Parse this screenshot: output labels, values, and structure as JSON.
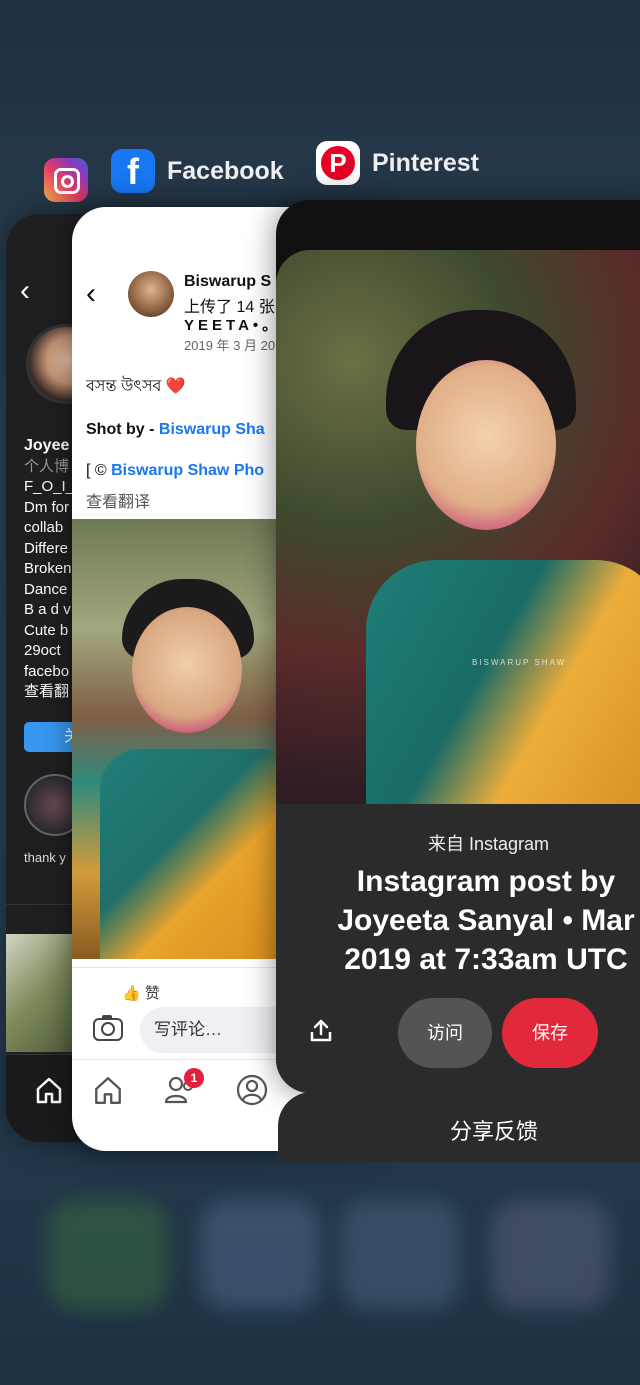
{
  "app_switcher": {
    "instagram": {
      "icon": "instagram-icon"
    },
    "facebook": {
      "label": "Facebook",
      "icon": "facebook-icon"
    },
    "pinterest": {
      "label": "Pinterest",
      "icon": "pinterest-icon"
    }
  },
  "instagram_card": {
    "bio_lines": [
      "Joyee",
      "个人博",
      "F_O_I_I",
      "Dm for",
      "collab",
      "Differe",
      "Broken",
      "Dance",
      "B a d v",
      "Cute b",
      "29oct",
      "facebo",
      "查看翻"
    ],
    "button_label": "关",
    "story_label": "thank y"
  },
  "facebook_card": {
    "author": "Biswarup S",
    "uploaded": "上传了 14 张",
    "album_title": "YEETA•。",
    "date": "2019 年 3 月 20",
    "caption_line1": "বসন্ত উৎসব ❤️",
    "shot_by_prefix": "Shot by - ",
    "shot_by_link": "Biswarup Sha",
    "credit_prefix": "[ © ",
    "credit_link": "Biswarup Shaw Pho",
    "translate": "查看翻译",
    "like_label": "赞",
    "comment_placeholder": "写评论…",
    "friends_badge": "1"
  },
  "pinterest_card": {
    "from_label": "来自 Instagram",
    "title_lines": [
      "Instagram post by",
      "Joyeeta Sanyal • Mar",
      "2019 at 7:33am UTC"
    ],
    "watermark": "BISWARUP SHAW",
    "visit_label": "访问",
    "save_label": "保存",
    "feedback_label": "分享反馈"
  },
  "colors": {
    "facebook_blue": "#1877f2",
    "pinterest_red": "#e60023",
    "instagram_button": "#3897f0"
  }
}
